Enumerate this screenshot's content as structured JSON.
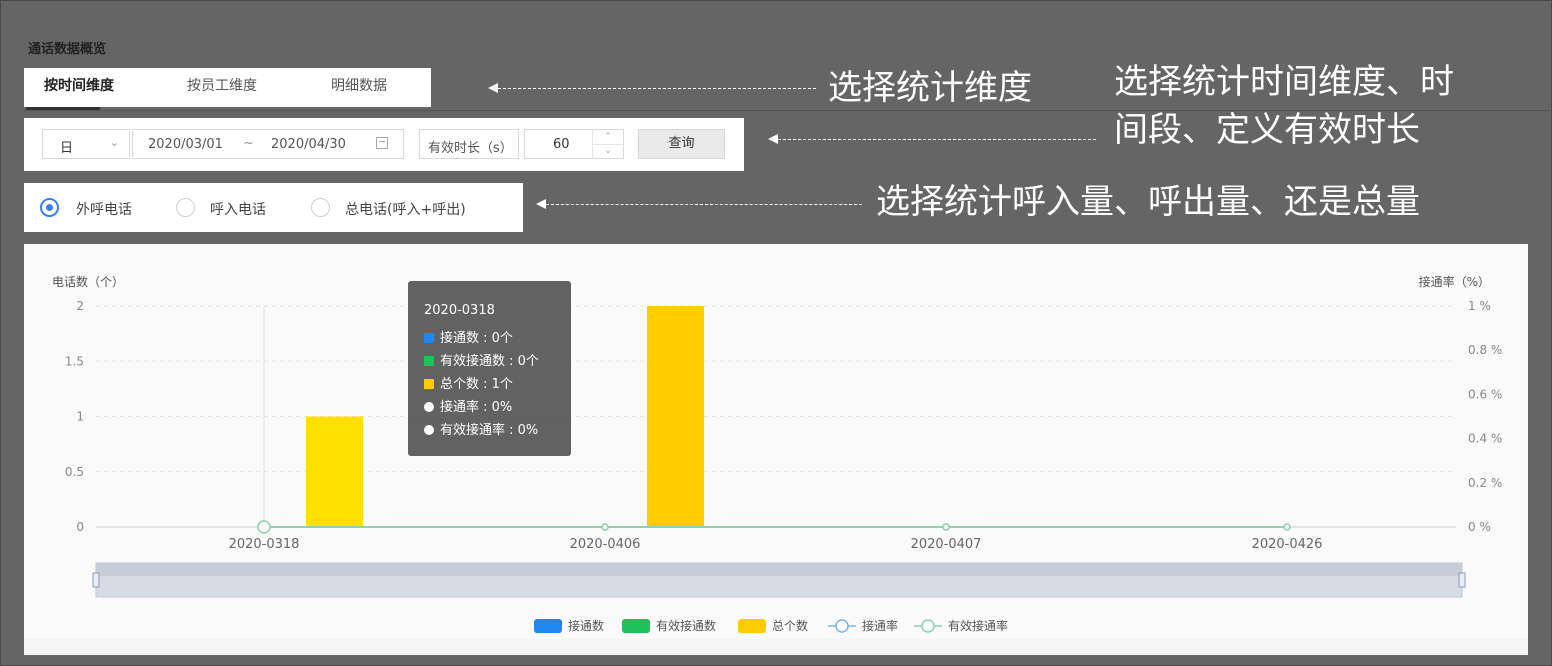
{
  "section_title": "通话数据概览",
  "tabs": [
    {
      "label": "按时间维度",
      "active": true
    },
    {
      "label": "按员工维度",
      "active": false
    },
    {
      "label": "明细数据",
      "active": false
    }
  ],
  "filters": {
    "granularity": "日",
    "start_date": "2020/03/01",
    "range_sep": "~",
    "end_date": "2020/04/30",
    "duration_label": "有效时长（s）",
    "duration_value": "60",
    "query_label": "查询"
  },
  "call_type": {
    "options": [
      {
        "label": "外呼电话",
        "selected": true
      },
      {
        "label": "呼入电话",
        "selected": false
      },
      {
        "label": "总电话(呼入+呼出)",
        "selected": false
      }
    ]
  },
  "annotations": {
    "tabs_note": "选择统计维度",
    "filters_note_line1": "选择统计时间维度、时",
    "filters_note_line2": "间段、定义有效时长",
    "radios_note": "选择统计呼入量、呼出量、还是总量"
  },
  "colors": {
    "connected": "#1e88f0",
    "effective": "#1ec15a",
    "total": "#ffcc00",
    "total_light": "#ffe000",
    "rate_line": "#8fd0b0",
    "accent": "#3b7ef0"
  },
  "chart_data": {
    "type": "bar",
    "left_axis_label": "电话数（个）",
    "right_axis_label": "接通率（%）",
    "left_ticks": [
      "0",
      "0.5",
      "1",
      "1.5",
      "2"
    ],
    "right_ticks": [
      "0 %",
      "0.2 %",
      "0.4 %",
      "0.6 %",
      "0.8 %",
      "1 %"
    ],
    "ylim_left": [
      0,
      2
    ],
    "ylim_right": [
      0,
      1
    ],
    "categories": [
      "2020-0318",
      "2020-0406",
      "2020-0407",
      "2020-0426"
    ],
    "series": [
      {
        "name": "接通数",
        "kind": "bar",
        "values": [
          0,
          0,
          0,
          0
        ]
      },
      {
        "name": "有效接通数",
        "kind": "bar",
        "values": [
          0,
          0,
          0,
          0
        ]
      },
      {
        "name": "总个数",
        "kind": "bar",
        "values": [
          1,
          2,
          0,
          0
        ]
      },
      {
        "name": "接通率",
        "kind": "line",
        "values": [
          0,
          0,
          0,
          0
        ]
      },
      {
        "name": "有效接通率",
        "kind": "line",
        "values": [
          0,
          0,
          0,
          0
        ]
      }
    ],
    "grid": true,
    "legend_position": "bottom"
  },
  "tooltip": {
    "title": "2020-0318",
    "rows": [
      {
        "text": "接通数 : 0个",
        "marker": "square",
        "color": "#1e88f0"
      },
      {
        "text": "有效接通数 : 0个",
        "marker": "square",
        "color": "#1ec15a"
      },
      {
        "text": "总个数 : 1个",
        "marker": "square",
        "color": "#ffcc00"
      },
      {
        "text": "接通率 : 0%",
        "marker": "dot",
        "color": "#ffffff"
      },
      {
        "text": "有效接通率 : 0%",
        "marker": "dot",
        "color": "#ffffff"
      }
    ]
  }
}
